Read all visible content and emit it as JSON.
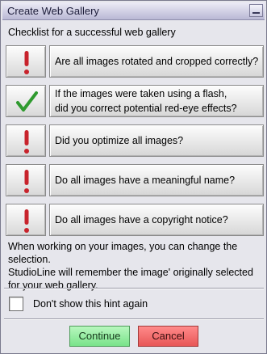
{
  "window": {
    "title": "Create Web Gallery"
  },
  "heading": "Checklist for a successful web gallery",
  "checklist": [
    {
      "status": "not-done",
      "icon": "exclamation-icon",
      "text": "Are all images rotated and cropped correctly?"
    },
    {
      "status": "done",
      "icon": "checkmark-icon",
      "text": "If the images were taken using a flash,\ndid you correct potential red-eye effects?"
    },
    {
      "status": "not-done",
      "icon": "exclamation-icon",
      "text": "Did you optimize all images?"
    },
    {
      "status": "not-done",
      "icon": "exclamation-icon",
      "text": "Do all images have a meaningful name?"
    },
    {
      "status": "not-done",
      "icon": "exclamation-icon",
      "text": "Do all images have a copyright notice?"
    }
  ],
  "info_text": "When working on your images, you can change the selection.\nStudioLine will remember the image' originally selected\nfor your web gallery.",
  "dont_show": {
    "label": "Don't show this hint again",
    "checked": false
  },
  "buttons": {
    "continue": "Continue",
    "cancel": "Cancel"
  },
  "colors": {
    "exclamation": "#c8232c",
    "checkmark": "#2f9a2f",
    "continue_bg": "#8ef09a",
    "cancel_bg": "#f16a6a"
  }
}
